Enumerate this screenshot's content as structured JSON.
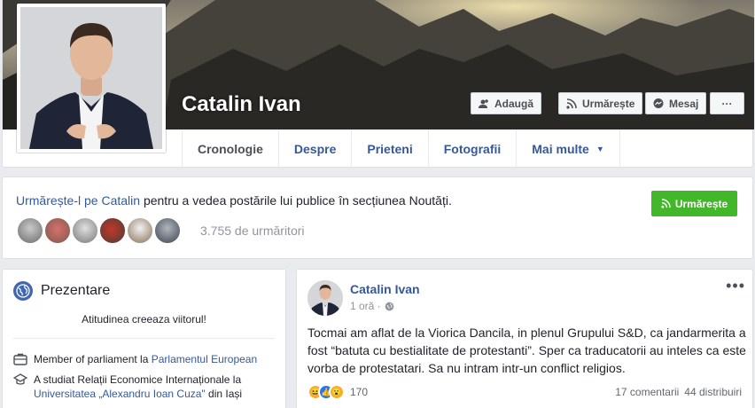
{
  "profile": {
    "name": "Catalin Ivan"
  },
  "actions": {
    "add_friend": "Adaugă",
    "follow": "Urmărește",
    "message": "Mesaj",
    "more": "···"
  },
  "tabs": [
    {
      "label": "Cronologie"
    },
    {
      "label": "Despre"
    },
    {
      "label": "Prieteni"
    },
    {
      "label": "Fotografii"
    },
    {
      "label": "Mai multe"
    }
  ],
  "follow_prompt": {
    "link": "Urmărește-l pe Catalin",
    "text": " pentru a vedea postările lui publice în secțiunea Noutăți.",
    "button": "Urmărește",
    "followers": "3.755 de urmăritori"
  },
  "intro": {
    "title": "Prezentare",
    "bio": "Atitudinea creeaza viitorul!",
    "work_prefix": "Member of parliament la ",
    "work_link": "Parlamentul European",
    "edu_prefix": "A studiat Relații Economice Internaționale la ",
    "edu_link": "Universitatea „Alexandru Ioan Cuza\"",
    "edu_suffix": " din Iași"
  },
  "post": {
    "author": "Catalin Ivan",
    "time": "1 oră · ",
    "more": "•••",
    "body": "Tocmai am aflat de la Viorica Dancila, in plenul Grupului S&D, ca jandarmerita a fost “batuta cu bestialitate de protestanti”. Sper ca traducatorii au inteles ca este vorba de protestatari. Sa nu intram intr-un conflict religios.",
    "reactions_count": "170",
    "comments": "17 comentarii",
    "shares": "44 distribuiri"
  },
  "colors": {
    "link": "#365899",
    "green": "#42b72a",
    "facebook_blue": "#4267b2"
  }
}
